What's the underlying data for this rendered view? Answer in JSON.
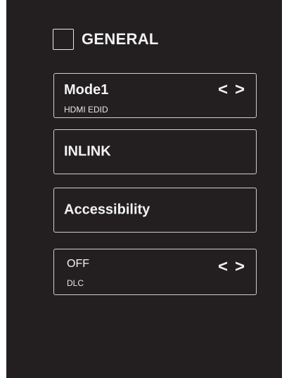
{
  "header": {
    "title": "GENERAL",
    "icon": "square-outline-icon"
  },
  "items": {
    "mode": {
      "title": "Mode1",
      "subtitle": "HDMI EDID",
      "prev_arrow": "<",
      "next_arrow": ">"
    },
    "inlink": {
      "title": "INLINK"
    },
    "accessibility": {
      "title": "Accessibility"
    },
    "dlc": {
      "value": "OFF",
      "subtitle": "DLC",
      "prev_arrow": "<",
      "next_arrow": ">"
    }
  },
  "colors": {
    "panel_background": "#231f20",
    "text": "#f2f2f2",
    "border": "#cfcfcf"
  }
}
